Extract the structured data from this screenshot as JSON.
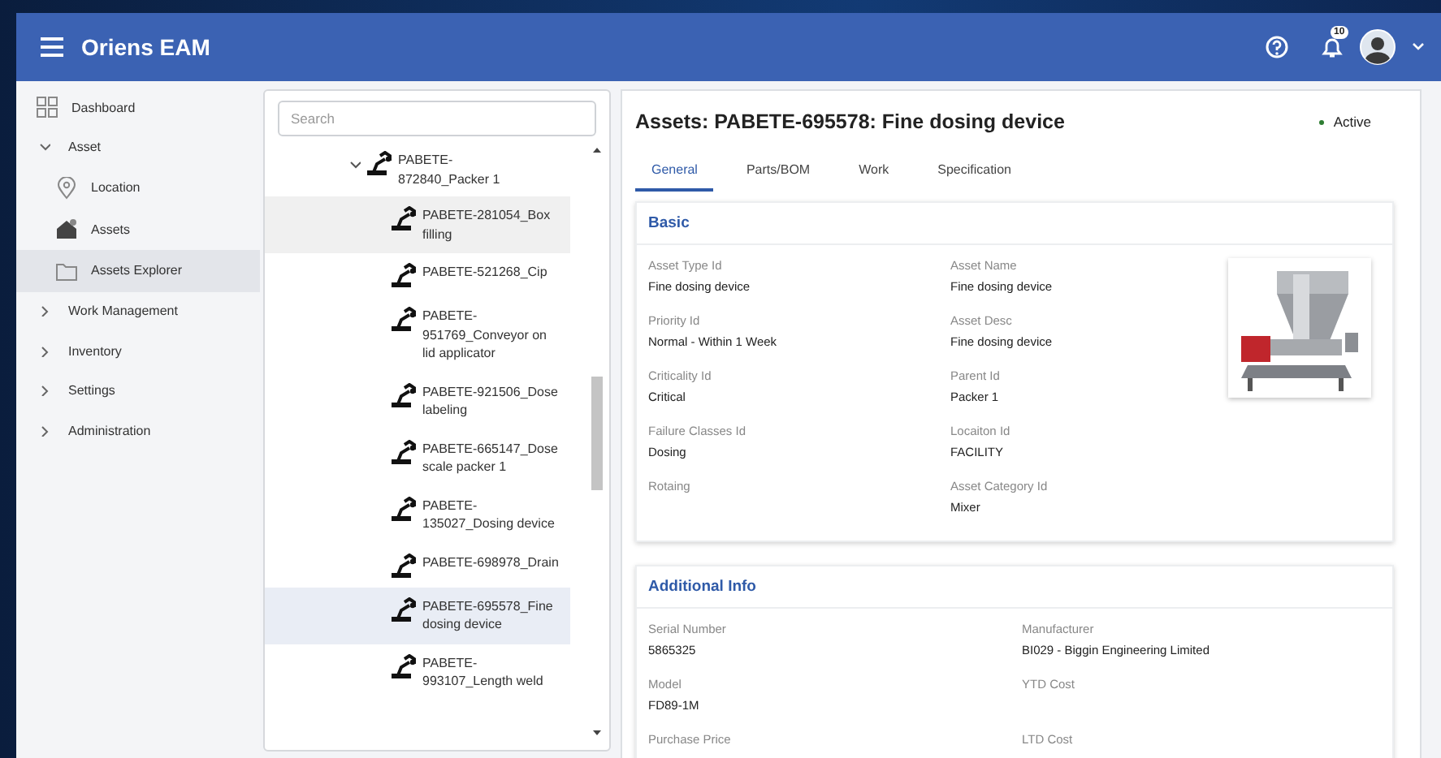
{
  "header": {
    "app_name": "Oriens EAM",
    "notification_count": "10"
  },
  "sidebar": {
    "items": [
      {
        "label": "Dashboard",
        "kind": "dashboard",
        "selected": false
      },
      {
        "label": "Asset",
        "kind": "group",
        "expanded": true,
        "selected": false,
        "children": [
          {
            "label": "Location",
            "kind": "location",
            "selected": false
          },
          {
            "label": "Assets",
            "kind": "assets",
            "selected": false
          },
          {
            "label": "Assets Explorer",
            "kind": "explorer",
            "selected": true
          }
        ]
      },
      {
        "label": "Work Management",
        "kind": "group",
        "expanded": false,
        "selected": false
      },
      {
        "label": "Inventory",
        "kind": "group",
        "expanded": false,
        "selected": false
      },
      {
        "label": "Settings",
        "kind": "group",
        "expanded": false,
        "selected": false
      },
      {
        "label": "Administration",
        "kind": "group",
        "expanded": false,
        "selected": false
      }
    ]
  },
  "tree": {
    "search": {
      "placeholder": "Search"
    },
    "items": [
      {
        "label": "PABETE-872840_Packer 1",
        "expanded": true,
        "selected": false,
        "hovered": false,
        "children": [
          {
            "label": "PABETE-281054_Box filling",
            "selected": false,
            "hovered": true
          },
          {
            "label": "PABETE-521268_Cip",
            "selected": false,
            "hovered": false
          },
          {
            "label": "PABETE-951769_Conveyor on lid applicator",
            "selected": false,
            "hovered": false
          },
          {
            "label": "PABETE-921506_Dose labeling",
            "selected": false,
            "hovered": false
          },
          {
            "label": "PABETE-665147_Dose scale packer 1",
            "selected": false,
            "hovered": false
          },
          {
            "label": "PABETE-135027_Dosing device",
            "selected": false,
            "hovered": false
          },
          {
            "label": "PABETE-698978_Drain",
            "selected": false,
            "hovered": false
          },
          {
            "label": "PABETE-695578_Fine dosing device",
            "selected": true,
            "hovered": false
          },
          {
            "label": "PABETE-993107_Length weld",
            "selected": false,
            "hovered": false
          }
        ]
      }
    ]
  },
  "detail": {
    "title": "Assets: PABETE-695578: Fine dosing device",
    "status": {
      "label": "Active",
      "color": "#2e7d32"
    },
    "tabs": [
      {
        "label": "General",
        "selected": true
      },
      {
        "label": "Parts/BOM",
        "selected": false
      },
      {
        "label": "Work",
        "selected": false
      },
      {
        "label": "Specification",
        "selected": false
      }
    ],
    "sections": [
      {
        "title": "Basic",
        "fields": [
          {
            "label": "Asset Type Id",
            "value": "Fine dosing device"
          },
          {
            "label": "Asset Name",
            "value": "Fine dosing device"
          },
          {
            "label": "Priority Id",
            "value": "Normal - Within 1 Week"
          },
          {
            "label": "Asset Desc",
            "value": "Fine dosing device"
          },
          {
            "label": "Criticality Id",
            "value": "Critical"
          },
          {
            "label": "Parent Id",
            "value": "Packer 1"
          },
          {
            "label": "Failure Classes Id",
            "value": "Dosing"
          },
          {
            "label": "Locaiton Id",
            "value": "FACILITY"
          },
          {
            "label": "Rotaing"
          },
          {
            "label": "Asset Category Id",
            "value": "Mixer"
          }
        ]
      },
      {
        "title": "Additional Info",
        "fields": [
          {
            "label": "Serial Number",
            "value": "5865325"
          },
          {
            "label": "Manufacturer",
            "value": "BI029 - Biggin Engineering Limited"
          },
          {
            "label": "Model",
            "value": "FD89-1M"
          },
          {
            "label": "YTD Cost"
          },
          {
            "label": "Purchase Price"
          },
          {
            "label": "LTD Cost"
          }
        ]
      }
    ]
  }
}
